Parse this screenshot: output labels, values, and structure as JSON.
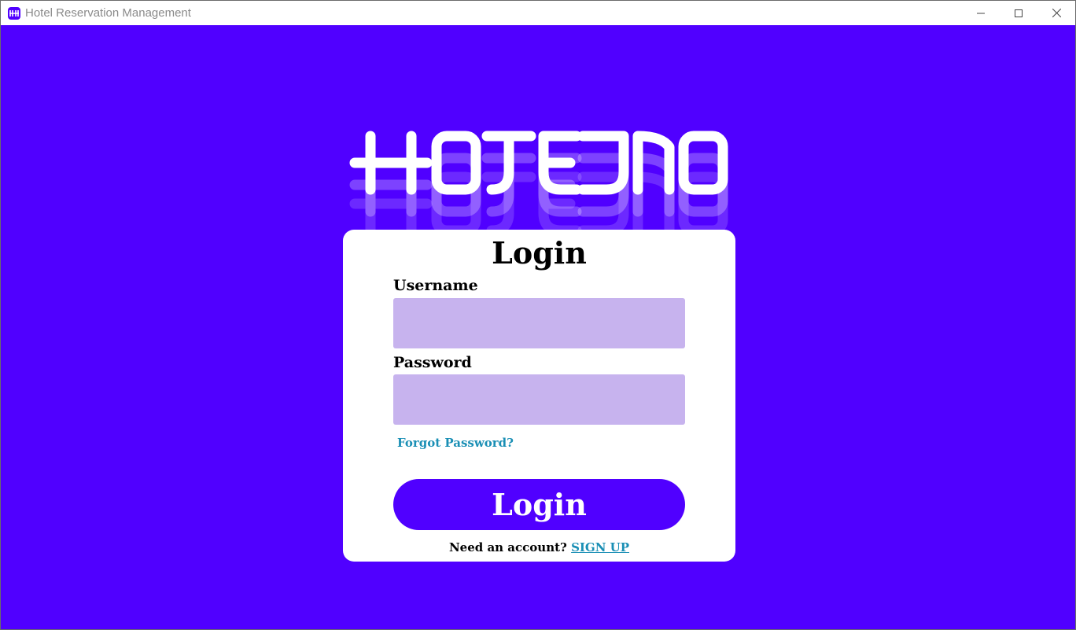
{
  "window": {
    "title": "Hotel Reservation Management",
    "app_icon": "hotelino-logo-icon",
    "controls": [
      "minimize-icon",
      "maximize-icon",
      "close-icon"
    ]
  },
  "brand": {
    "logo_text": "HOTELINO",
    "background_color": "#5000ff"
  },
  "login_form": {
    "title": "Login",
    "username_label": "Username",
    "username_value": "",
    "password_label": "Password",
    "password_value": "",
    "input_color": "#c7b3ee",
    "forgot_password": "Forgot Password?",
    "submit_label": "Login",
    "signup_prompt": "Need an account?",
    "signup_link": "SIGN UP",
    "link_color": "#1a8fb5"
  }
}
